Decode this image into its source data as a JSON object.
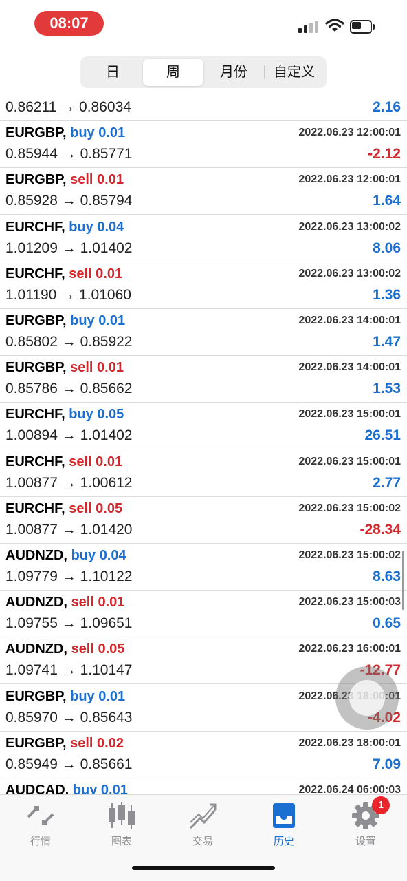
{
  "status_bar": {
    "time": "08:07"
  },
  "period_tabs": [
    {
      "label": "日",
      "active": false
    },
    {
      "label": "周",
      "active": true
    },
    {
      "label": "月份",
      "active": false
    },
    {
      "label": "自定义",
      "active": false
    }
  ],
  "trades": [
    {
      "symbol": "",
      "side": "",
      "lots": "",
      "prices": "0.86211 → 0.86034",
      "time": "",
      "profit": "2.16",
      "profit_sign": "pos"
    },
    {
      "symbol": "EURGBP,",
      "side": "buy",
      "lots": "0.01",
      "prices": "0.85944 → 0.85771",
      "time": "2022.06.23 12:00:01",
      "profit": "-2.12",
      "profit_sign": "neg"
    },
    {
      "symbol": "EURGBP,",
      "side": "sell",
      "lots": "0.01",
      "prices": "0.85928 → 0.85794",
      "time": "2022.06.23 12:00:01",
      "profit": "1.64",
      "profit_sign": "pos"
    },
    {
      "symbol": "EURCHF,",
      "side": "buy",
      "lots": "0.04",
      "prices": "1.01209 → 1.01402",
      "time": "2022.06.23 13:00:02",
      "profit": "8.06",
      "profit_sign": "pos"
    },
    {
      "symbol": "EURCHF,",
      "side": "sell",
      "lots": "0.01",
      "prices": "1.01190 → 1.01060",
      "time": "2022.06.23 13:00:02",
      "profit": "1.36",
      "profit_sign": "pos"
    },
    {
      "symbol": "EURGBP,",
      "side": "buy",
      "lots": "0.01",
      "prices": "0.85802 → 0.85922",
      "time": "2022.06.23 14:00:01",
      "profit": "1.47",
      "profit_sign": "pos"
    },
    {
      "symbol": "EURGBP,",
      "side": "sell",
      "lots": "0.01",
      "prices": "0.85786 → 0.85662",
      "time": "2022.06.23 14:00:01",
      "profit": "1.53",
      "profit_sign": "pos"
    },
    {
      "symbol": "EURCHF,",
      "side": "buy",
      "lots": "0.05",
      "prices": "1.00894 → 1.01402",
      "time": "2022.06.23 15:00:01",
      "profit": "26.51",
      "profit_sign": "pos"
    },
    {
      "symbol": "EURCHF,",
      "side": "sell",
      "lots": "0.01",
      "prices": "1.00877 → 1.00612",
      "time": "2022.06.23 15:00:01",
      "profit": "2.77",
      "profit_sign": "pos"
    },
    {
      "symbol": "EURCHF,",
      "side": "sell",
      "lots": "0.05",
      "prices": "1.00877 → 1.01420",
      "time": "2022.06.23 15:00:02",
      "profit": "-28.34",
      "profit_sign": "neg"
    },
    {
      "symbol": "AUDNZD,",
      "side": "buy",
      "lots": "0.04",
      "prices": "1.09779 → 1.10122",
      "time": "2022.06.23 15:00:02",
      "profit": "8.63",
      "profit_sign": "pos"
    },
    {
      "symbol": "AUDNZD,",
      "side": "sell",
      "lots": "0.01",
      "prices": "1.09755 → 1.09651",
      "time": "2022.06.23 15:00:03",
      "profit": "0.65",
      "profit_sign": "pos"
    },
    {
      "symbol": "AUDNZD,",
      "side": "sell",
      "lots": "0.05",
      "prices": "1.09741 → 1.10147",
      "time": "2022.06.23 16:00:01",
      "profit": "-12.77",
      "profit_sign": "neg"
    },
    {
      "symbol": "EURGBP,",
      "side": "buy",
      "lots": "0.01",
      "prices": "0.85970 → 0.85643",
      "time": "2022.06.23 18:00:01",
      "profit": "-4.02",
      "profit_sign": "neg"
    },
    {
      "symbol": "EURGBP,",
      "side": "sell",
      "lots": "0.02",
      "prices": "0.85949 → 0.85661",
      "time": "2022.06.23 18:00:01",
      "profit": "7.09",
      "profit_sign": "pos"
    },
    {
      "symbol": "AUDCAD,",
      "side": "buy",
      "lots": "0.01",
      "prices": "",
      "time": "2022.06.24 06:00:03",
      "profit": "",
      "profit_sign": "pos"
    }
  ],
  "tabbar": {
    "items": [
      {
        "label": "行情",
        "icon": "quotes-icon",
        "active": false
      },
      {
        "label": "图表",
        "icon": "chart-icon",
        "active": false
      },
      {
        "label": "交易",
        "icon": "trade-icon",
        "active": false
      },
      {
        "label": "历史",
        "icon": "history-icon",
        "active": true
      },
      {
        "label": "设置",
        "icon": "gear-icon",
        "active": false,
        "badge": "1"
      }
    ]
  },
  "colors": {
    "buy": "#1a6fd1",
    "sell": "#d0282c",
    "active_tab": "#1a6fd1",
    "inactive_tab": "#8e8e93",
    "time_pill": "#e23a3a"
  }
}
